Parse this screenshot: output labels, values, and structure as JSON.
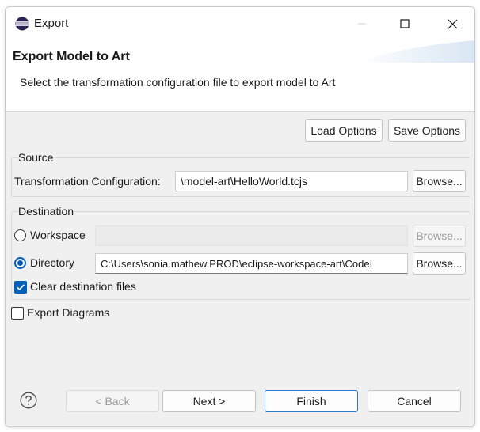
{
  "window": {
    "title": "Export"
  },
  "header": {
    "title": "Export Model to Art",
    "description": "Select the transformation configuration file to export model to Art"
  },
  "options": {
    "load_label": "Load Options",
    "save_label": "Save Options"
  },
  "source": {
    "group_label": "Source",
    "config_label": "Transformation Configuration:",
    "config_value": "\\model-art\\HelloWorld.tcjs",
    "browse_label": "Browse..."
  },
  "destination": {
    "group_label": "Destination",
    "workspace_label": "Workspace",
    "workspace_value": "",
    "workspace_selected": false,
    "workspace_browse_label": "Browse...",
    "directory_label": "Directory",
    "directory_value": "C:\\Users\\sonia.mathew.PROD\\eclipse-workspace-art\\CodeI",
    "directory_selected": true,
    "directory_browse_label": "Browse...",
    "clear_label": "Clear destination files",
    "clear_checked": true
  },
  "export_diagrams": {
    "label": "Export Diagrams",
    "checked": false
  },
  "footer": {
    "back_label": "< Back",
    "next_label": "Next >",
    "finish_label": "Finish",
    "cancel_label": "Cancel"
  },
  "colors": {
    "accent": "#005fb8",
    "default_button_border": "#2b7bd1"
  }
}
